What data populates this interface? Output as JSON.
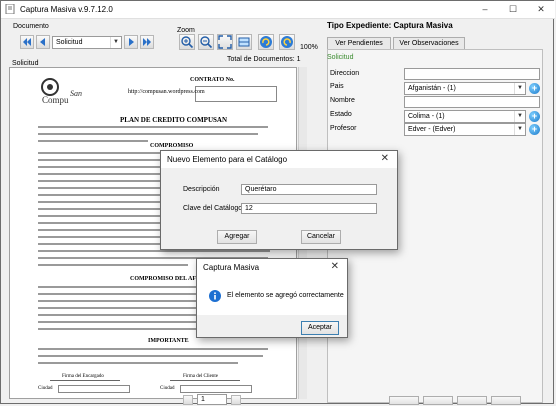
{
  "window": {
    "title": "Captura Masiva v.9.7.12.0"
  },
  "toolbar": {
    "document_label": "Documento",
    "document_select": "Solicitud",
    "zoom_label": "Zoom",
    "zoom_percent": "100%",
    "solicitud_label": "Solicitud",
    "total_docs": "Total de Documentos: 1"
  },
  "right_panel": {
    "title": "Tipo Expediente: Captura Masiva",
    "tabs": [
      "Ver Pendientes",
      "Ver Observaciones"
    ],
    "section_label": "Solicitud",
    "fields": [
      {
        "label": "Direccion",
        "value": ""
      },
      {
        "label": "Pais",
        "value": "Afganistán - (1)"
      },
      {
        "label": "Nombre",
        "value": ""
      },
      {
        "label": "Estado",
        "value": "Colima - (1)"
      },
      {
        "label": "Profesor",
        "value": "Edver - (Edver)"
      }
    ]
  },
  "document": {
    "brand": "Compu San",
    "contract_label": "CONTRATO No.",
    "url": "http://compusan.wordpress.com",
    "title": "PLAN DE CREDITO COMPUSAN",
    "section1": "COMPROMISO",
    "section2": "COMPROMISO DEL AFILIADO",
    "section3": "IMPORTANTE",
    "sig_left": "Firma del Encargado",
    "sig_right": "Firma del Cliente",
    "city_left": "Ciudad",
    "city_right": "Ciudad"
  },
  "catalog_dialog": {
    "title": "Nuevo Elemento para el Catálogo",
    "description_label": "Descripción",
    "description_value": "Querétaro",
    "key_label": "Clave del Catálogo",
    "key_value": "12",
    "accept": "Agregar",
    "cancel": "Cancelar"
  },
  "message_dialog": {
    "title": "Captura Masiva",
    "message": "El elemento se agregó correctamente",
    "ok": "Aceptar"
  },
  "pager": {
    "page": "1"
  }
}
